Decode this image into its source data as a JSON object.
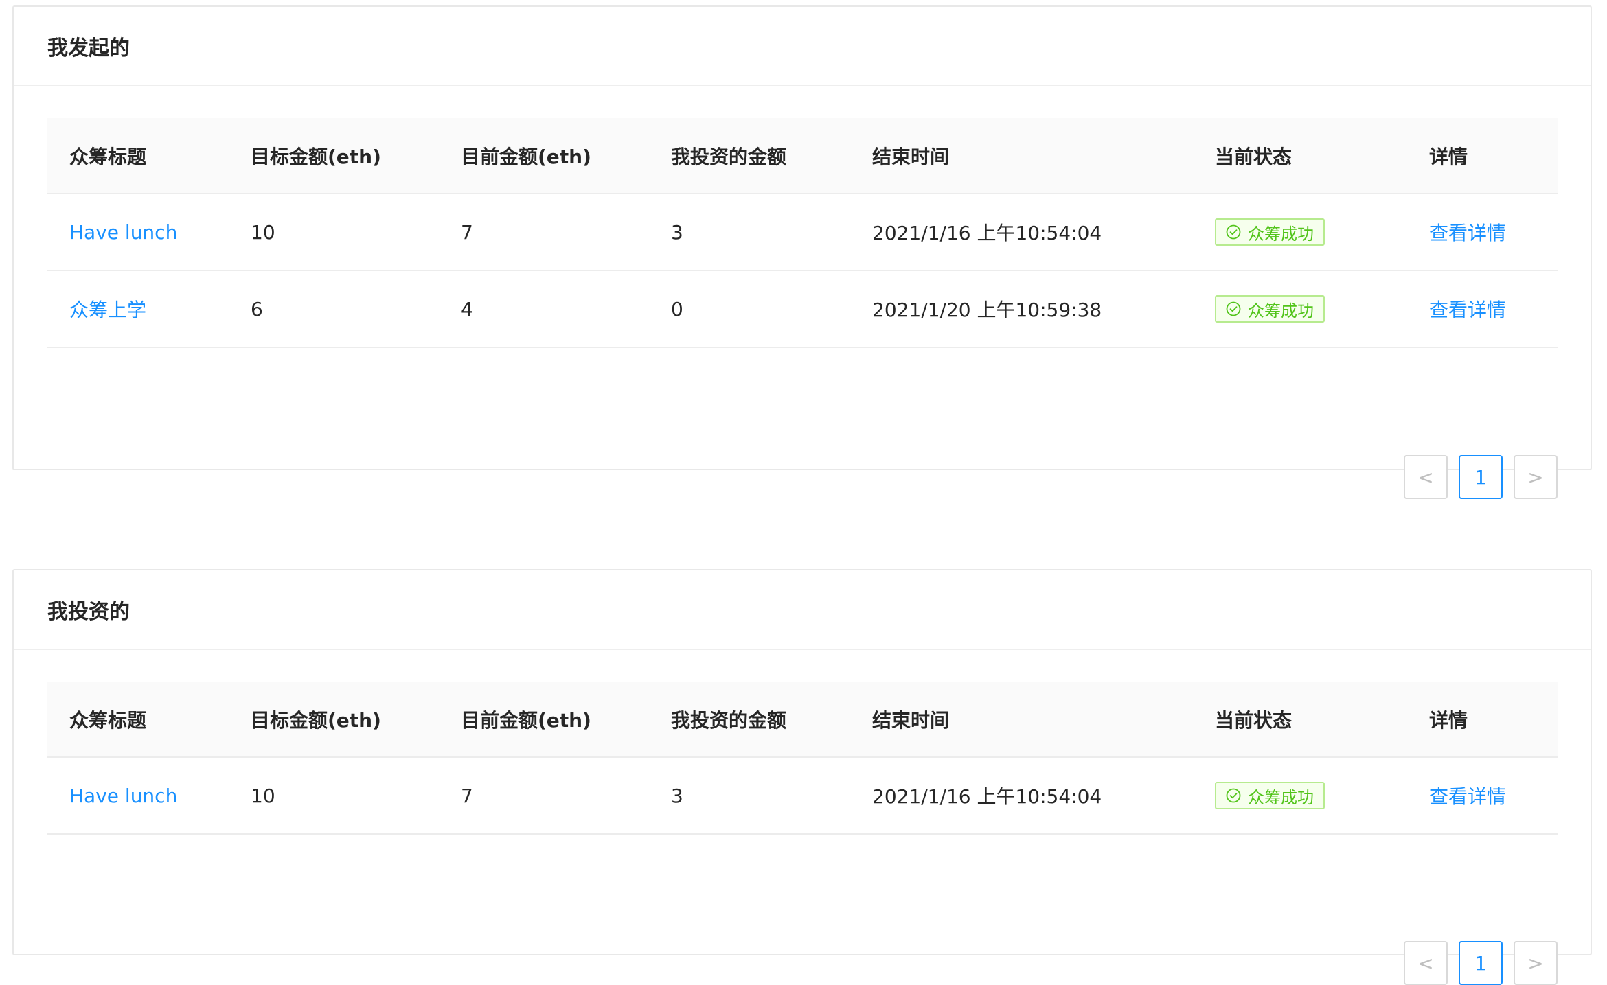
{
  "sections": [
    {
      "title": "我发起的",
      "columns": [
        "众筹标题",
        "目标金额(eth)",
        "目前金额(eth)",
        "我投资的金额",
        "结束时间",
        "当前状态",
        "详情"
      ],
      "rows": [
        {
          "title": "Have lunch",
          "target": "10",
          "current": "7",
          "my_investment": "3",
          "end_time": "2021/1/16 上午10:54:04",
          "status": "众筹成功",
          "detail": "查看详情"
        },
        {
          "title": "众筹上学",
          "target": "6",
          "current": "4",
          "my_investment": "0",
          "end_time": "2021/1/20 上午10:59:38",
          "status": "众筹成功",
          "detail": "查看详情"
        }
      ],
      "pagination": {
        "prev": "<",
        "current_page": "1",
        "next": ">"
      }
    },
    {
      "title": "我投资的",
      "columns": [
        "众筹标题",
        "目标金额(eth)",
        "目前金额(eth)",
        "我投资的金额",
        "结束时间",
        "当前状态",
        "详情"
      ],
      "rows": [
        {
          "title": "Have lunch",
          "target": "10",
          "current": "7",
          "my_investment": "3",
          "end_time": "2021/1/16 上午10:54:04",
          "status": "众筹成功",
          "detail": "查看详情"
        }
      ],
      "pagination": {
        "prev": "<",
        "current_page": "1",
        "next": ">"
      }
    }
  ],
  "colors": {
    "link": "#1890ff",
    "success": "#52c41a",
    "success_border": "#b7eb8f",
    "success_bg": "#f6ffed"
  }
}
